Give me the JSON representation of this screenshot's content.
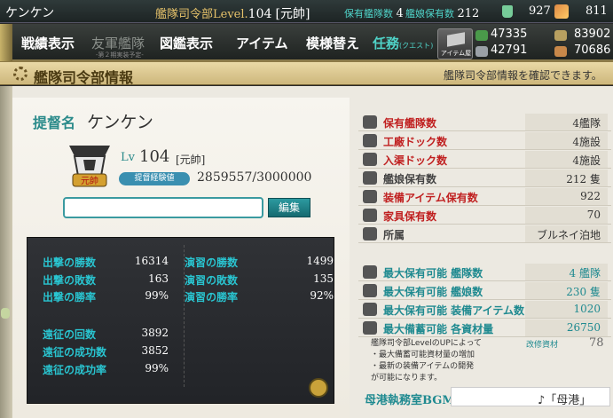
{
  "topbar": {
    "player_name": "ケンケン",
    "hq_label": "艦隊司令部Level.",
    "hq_level": "104",
    "rank": "[元帥]",
    "fleets_label": "保有艦隊数",
    "fleets_value": "4",
    "ships_label": "艦娘保有数",
    "ships_value": "212",
    "bucket_value": "927",
    "devmat_value": "811"
  },
  "nav": {
    "items": [
      "戦績表示",
      "友軍艦隊",
      "図鑑表示",
      "アイテム",
      "模様替え"
    ],
    "disabled_sub": "-第２期実装予定-",
    "quest_label": "任務",
    "quest_sub": "(クエスト)",
    "itemshop_label": "アイテム屋"
  },
  "resources": {
    "fuel": "47335",
    "ammo": "83902",
    "steel": "42791",
    "bauxite": "70686"
  },
  "header": {
    "title": "艦隊司令部情報",
    "notice": "艦隊司令部情報を確認できます。"
  },
  "admiral": {
    "name_label": "提督名",
    "name": "ケンケン",
    "rank_badge": "元帥",
    "lv_label": "Lv",
    "level": "104",
    "rank": "[元帥]",
    "exp_badge": "提督経験値",
    "exp": "2859557/3000000",
    "input_placeholder": "",
    "edit_button": "編集"
  },
  "stats": {
    "left": [
      {
        "label": "出撃の勝数",
        "value": "16314"
      },
      {
        "label": "出撃の敗数",
        "value": "163"
      },
      {
        "label": "出撃の勝率",
        "value": "99%"
      },
      {
        "label": "遠征の回数",
        "value": "3892"
      },
      {
        "label": "遠征の成功数",
        "value": "3852"
      },
      {
        "label": "遠征の成功率",
        "value": "99%"
      }
    ],
    "right": [
      {
        "label": "演習の勝数",
        "value": "1499"
      },
      {
        "label": "演習の敗数",
        "value": "135"
      },
      {
        "label": "演習の勝率",
        "value": "92%"
      }
    ]
  },
  "summary": [
    {
      "label": "保有艦隊数",
      "value": "4艦隊"
    },
    {
      "label": "工廠ドック数",
      "value": "4施設"
    },
    {
      "label": "入渠ドック数",
      "value": "4施設"
    },
    {
      "label": "艦娘保有数",
      "value": "212 隻"
    },
    {
      "label": "装備アイテム保有数",
      "value": "922"
    },
    {
      "label": "家具保有数",
      "value": "70"
    },
    {
      "label": "所属",
      "value": "ブルネイ泊地"
    }
  ],
  "limits": [
    {
      "label": "最大保有可能 艦隊数",
      "value": "4 艦隊"
    },
    {
      "label": "最大保有可能 艦娘数",
      "value": "230 隻"
    },
    {
      "label": "最大保有可能 装備アイテム数",
      "value": "1020"
    },
    {
      "label": "最大備蓄可能 各資材量",
      "value": "26750"
    }
  ],
  "note": {
    "lines": [
      "艦隊司令部LevelのUPによって",
      "・最大備蓄可能資材量の増加",
      "・最新の装備アイテムの開発",
      "が可能になります。"
    ],
    "kaisyu_label": "改修資材",
    "kaisyu_value": "78"
  },
  "bgm": {
    "label": "母港執務室BGM",
    "value": "♪「母港」"
  }
}
